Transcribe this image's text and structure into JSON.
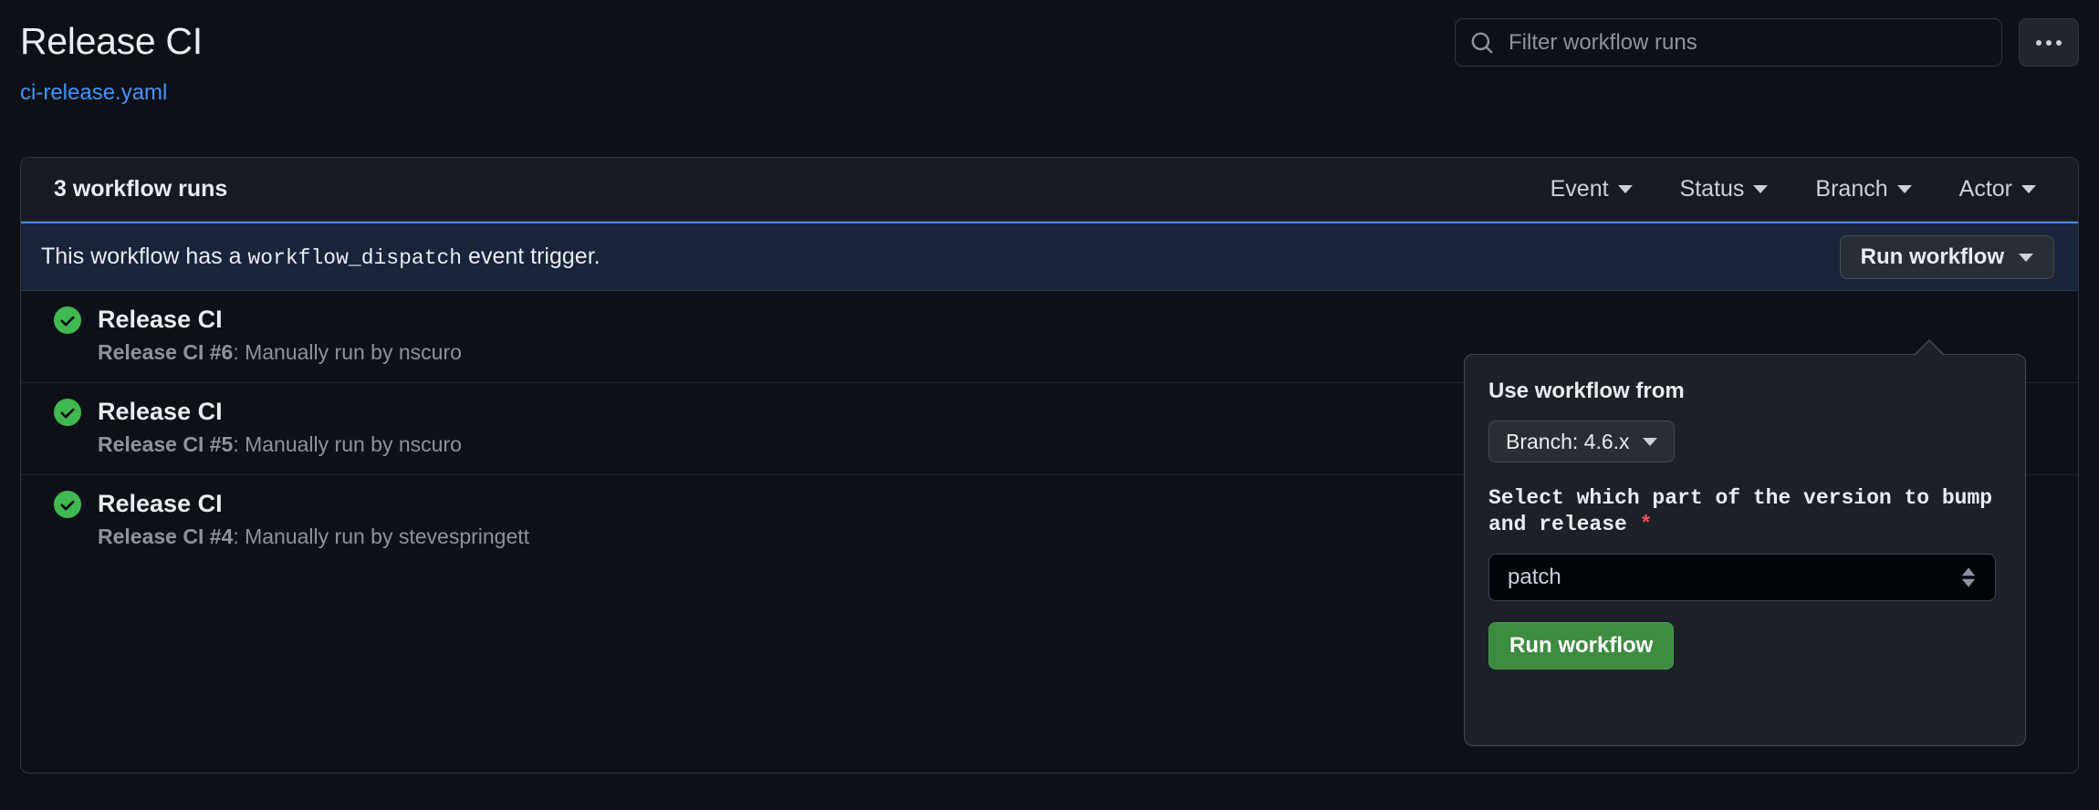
{
  "header": {
    "title": "Release CI",
    "workflow_file": "ci-release.yaml",
    "search_placeholder": "Filter workflow runs",
    "search_value": "",
    "search_icon": "search-icon",
    "kebab_icon": "kebab-horizontal-icon"
  },
  "card": {
    "runs_count_label": "3 workflow runs",
    "filters": [
      {
        "label": "Event",
        "icon": "chevron-down-icon"
      },
      {
        "label": "Status",
        "icon": "chevron-down-icon"
      },
      {
        "label": "Branch",
        "icon": "chevron-down-icon"
      },
      {
        "label": "Actor",
        "icon": "chevron-down-icon"
      }
    ]
  },
  "banner": {
    "text_before": "This workflow has a ",
    "code": "workflow_dispatch",
    "text_after": " event trigger.",
    "run_workflow_label": "Run workflow",
    "run_workflow_caret": "chevron-down-icon",
    "accent_color": "#388bfd",
    "background_color": "#192339"
  },
  "runs": [
    {
      "status_icon": "check-circle-fill-icon",
      "status_color": "#3fb950",
      "title": "Release CI",
      "sub_bold": "Release CI #6",
      "sub_rest": ": Manually run by nscuro"
    },
    {
      "status_icon": "check-circle-fill-icon",
      "status_color": "#3fb950",
      "title": "Release CI",
      "sub_bold": "Release CI #5",
      "sub_rest": ": Manually run by nscuro"
    },
    {
      "status_icon": "check-circle-fill-icon",
      "status_color": "#3fb950",
      "title": "Release CI",
      "sub_bold": "Release CI #4",
      "sub_rest": ": Manually run by stevespringett"
    }
  ],
  "popover": {
    "use_workflow_from_label": "Use workflow from",
    "branch_button_label": "Branch: 4.6.x",
    "branch_caret_icon": "chevron-down-icon",
    "version_field_label": "Select which part of the version to bump and release",
    "required_marker": "*",
    "version_selected": "patch",
    "version_stepper_icon": "select-stepper-icon",
    "submit_label": "Run workflow",
    "submit_color": "#3d8c40"
  }
}
